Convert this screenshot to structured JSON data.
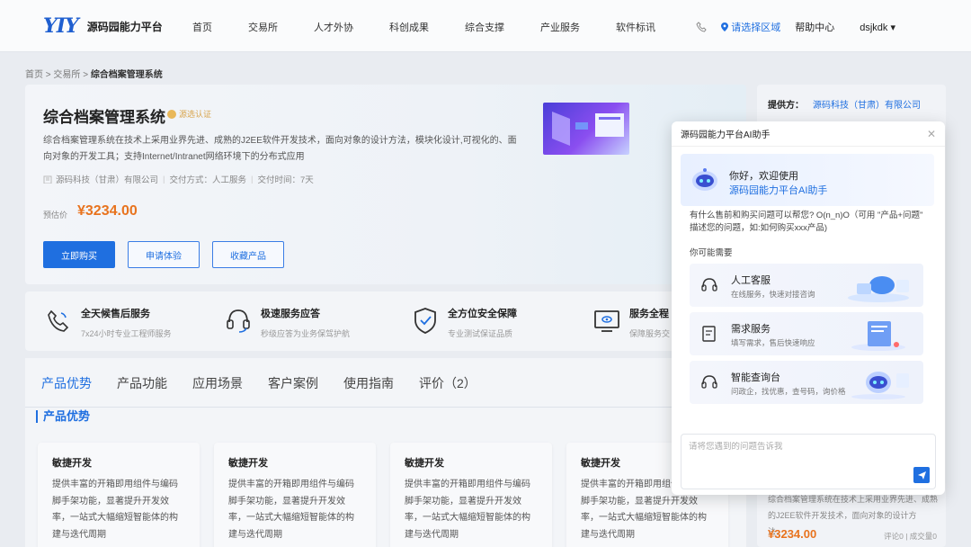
{
  "header": {
    "logo_mark": "YIY",
    "logo_text": "源码园能力平台",
    "nav": [
      "首页",
      "交易所",
      "人才外协",
      "科创成果",
      "综合支撑",
      "产业服务",
      "软件标讯"
    ],
    "region": "请选择区域",
    "help": "帮助中心",
    "user": "dsjkdk"
  },
  "breadcrumb": {
    "home": "首页",
    "exchange": "交易所",
    "current": "综合档案管理系统",
    "sep": ">"
  },
  "product": {
    "title": "综合档案管理系统",
    "badge": "源选认证",
    "description": "综合档案管理系统在技术上采用业界先进、成熟的J2EE软件开发技术，面向对象的设计方法，模块化设计,可视化的、面向对象的开发工具；支持Internet/Intranet网络环境下的分布式应用",
    "company": "源码科技（甘肃）有限公司",
    "delivery": "交付方式：人工服务",
    "delivery_time": "交付时间：7天",
    "price_label": "预估价",
    "price": "¥3234.00",
    "buy_label": "立即购买",
    "trial_label": "申请体验",
    "fav_label": "收藏产品"
  },
  "services": [
    {
      "title": "全天候售后服务",
      "sub": "7x24小时专业工程师服务"
    },
    {
      "title": "极速服务应答",
      "sub": "秒级应答为业务保驾护航"
    },
    {
      "title": "全方位安全保障",
      "sub": "专业测试保证品质"
    },
    {
      "title": "服务全程",
      "sub": "保障服务交"
    }
  ],
  "tabs": [
    "产品优势",
    "产品功能",
    "应用场景",
    "客户案例",
    "使用指南",
    "评价（2）"
  ],
  "section_title": "产品优势",
  "features": [
    {
      "title": "敏捷开发",
      "text": "提供丰富的开箱即用组件与编码脚手架功能，显著提升开发效率，一站式大幅缩短智能体的构建与迭代周期"
    },
    {
      "title": "敏捷开发",
      "text": "提供丰富的开箱即用组件与编码脚手架功能，显著提升开发效率，一站式大幅缩短智能体的构建与迭代周期"
    },
    {
      "title": "敏捷开发",
      "text": "提供丰富的开箱即用组件与编码脚手架功能，显著提升开发效率，一站式大幅缩短智能体的构建与迭代周期"
    },
    {
      "title": "敏捷开发",
      "text": "提供丰富的开箱即用组件与编码脚手架功能，显著提升开发效率，一站式大幅缩短智能体的构建与迭代周期"
    }
  ],
  "right": {
    "provider_label": "提供方：",
    "provider": "源码科技（甘肃）有限公司",
    "desc": "综合档案管理系统在技术上采用业界先进、成熟的J2EE软件开发技术，面向对象的设计方法，...",
    "price": "¥3234.00",
    "stats": "评论0 | 成交量0"
  },
  "chat": {
    "title": "源码园能力平台AI助手",
    "welcome_line1": "你好，欢迎使用",
    "welcome_line2": "源码园能力平台AI助手",
    "question": "有什么售前和购买问题可以帮您? O(n_n)O（可用 \"产品+问题\" 描述您的问题，如:如何购买xxx产品)",
    "maybe": "你可能需要",
    "options": [
      {
        "title": "人工客服",
        "sub": "在线服务，快速对接咨询",
        "icon": "headset-icon"
      },
      {
        "title": "需求服务",
        "sub": "填写需求，售后快速响应",
        "icon": "form-icon"
      },
      {
        "title": "智能查询台",
        "sub": "问政企，找优惠，查号码，询价格",
        "icon": "headset-icon"
      }
    ],
    "input_placeholder": "请将您遇到的问题告诉我"
  },
  "colors": {
    "accent": "#1f6fe0",
    "price": "#e8731e"
  }
}
